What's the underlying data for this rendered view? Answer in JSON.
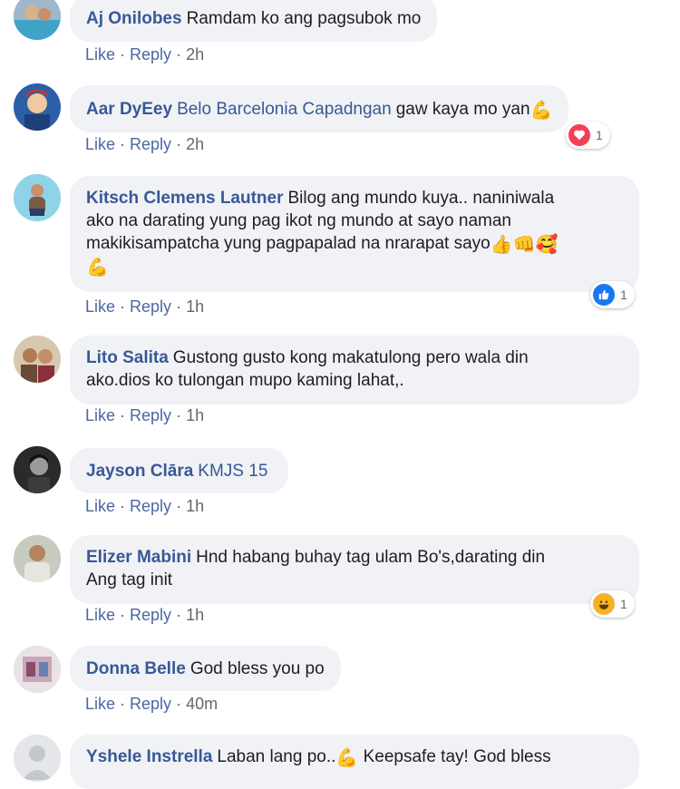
{
  "comments": [
    {
      "author": "Aj Onilobes",
      "text": "Ramdam ko ang pagsubok mo",
      "like": "Like",
      "reply": "Reply",
      "time": "2h"
    },
    {
      "author": "Aar DyEey",
      "mention": "Belo Barcelonia Capadngan",
      "text": "gaw kaya mo yan",
      "emoji": "💪",
      "like": "Like",
      "reply": "Reply",
      "time": "2h",
      "reaction": {
        "icon": "heart-reaction-icon",
        "count": "1"
      }
    },
    {
      "author": "Kitsch Clemens Lautner",
      "text_line1": "Bilog ang mundo kuya.. naniniwala",
      "text_line2": "ako na darating yung pag ikot ng mundo at sayo naman",
      "text_line3": "makikisampatcha yung pagpapalad na nrarapat sayo",
      "emojis_line3": "👍👊🥰",
      "emoji_line4": "💪",
      "like": "Like",
      "reply": "Reply",
      "time": "1h",
      "reaction": {
        "icon": "thumbs-up-reaction-icon",
        "count": "1"
      }
    },
    {
      "author": "Lito Salita",
      "text_line1": "Gustong gusto kong makatulong pero wala din",
      "text_line2": "ako.dios ko tulongan mupo kaming lahat,.",
      "like": "Like",
      "reply": "Reply",
      "time": "1h"
    },
    {
      "author": "Jayson Clāra",
      "mention": "KMJS 15",
      "like": "Like",
      "reply": "Reply",
      "time": "1h"
    },
    {
      "author": "Elizer Mabini",
      "text_line1": "Hnd habang buhay tag ulam Bo's,darating din",
      "text_line2": "Ang tag init",
      "like": "Like",
      "reply": "Reply",
      "time": "1h",
      "reaction": {
        "icon": "haha-reaction-icon",
        "count": "1"
      }
    },
    {
      "author": "Donna Belle",
      "text": "God bless you po",
      "like": "Like",
      "reply": "Reply",
      "time": "40m"
    },
    {
      "author": "Yshele Instrella",
      "text_a": "Laban lang po..",
      "emoji": "💪",
      "text_b": "Keepsafe tay! God bless"
    }
  ],
  "colors": {
    "author": "#385898",
    "bubble": "#f0f2f5",
    "meta": "#65676b",
    "heart": "#f33e58",
    "like_blue": "#1877f2",
    "haha": "#f7b125"
  }
}
